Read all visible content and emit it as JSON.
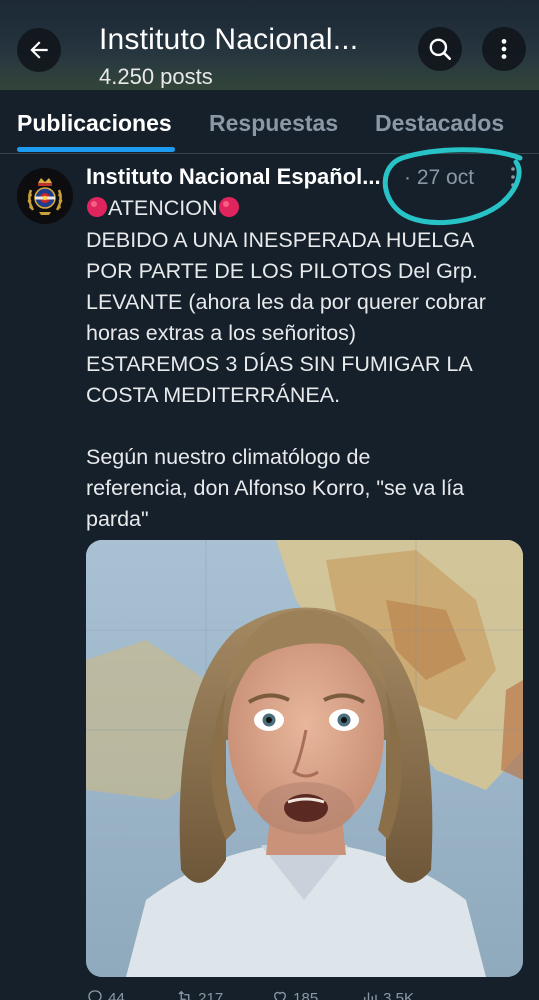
{
  "header": {
    "title": "Instituto Nacional...",
    "subtitle": "4.250 posts",
    "icons": [
      "back-arrow-icon",
      "search-icon",
      "more-vertical-icon"
    ]
  },
  "tabs": [
    {
      "label": "Publicaciones",
      "active": true
    },
    {
      "label": "Respuestas",
      "active": false
    },
    {
      "label": "Destacados",
      "active": false
    }
  ],
  "post": {
    "author": "Instituto Nacional Español...",
    "date": "· 27 oct",
    "lines": [
      "ATENCION",
      "DEBIDO A UNA INESPERADA HUELGA",
      "POR PARTE DE LOS PILOTOS Del Grp.",
      "LEVANTE (ahora les da por querer cobrar",
      "horas extras a los señoritos)",
      "ESTAREMOS 3 DÍAS SIN FUMIGAR LA",
      "COSTA MEDITERRÁNEA.",
      "",
      "Según nuestro climatólogo de",
      "referencia, don Alfonso Korro, \"se va lía",
      "parda\""
    ],
    "media_alt": "Hombre de pelo largo delante de un mapa de España",
    "actions": {
      "replies": "44",
      "reposts": "217",
      "likes": "185",
      "views": "3,5K"
    }
  },
  "colors": {
    "background": "#15202b",
    "accent": "#1d9bf0",
    "muted_text": "#8b98a5",
    "annotation": "#27c3c7",
    "red_dot": "#e0245e"
  }
}
